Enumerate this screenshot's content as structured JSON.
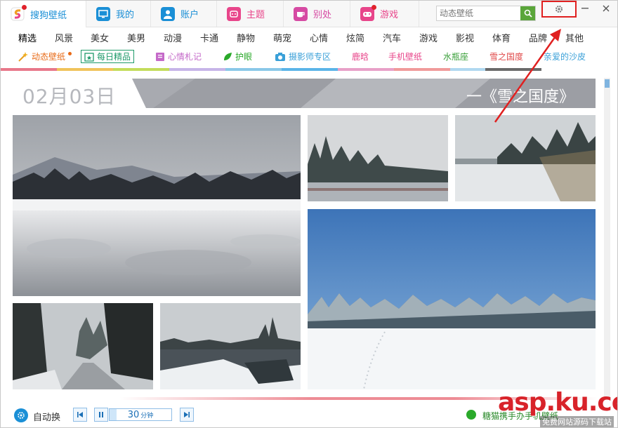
{
  "tabs": [
    {
      "label": "搜狗壁纸",
      "icon": "sogou-logo-icon",
      "color": "#1a8fd6"
    },
    {
      "label": "我的",
      "icon": "monitor-icon",
      "color": "#1a8fd6"
    },
    {
      "label": "账户",
      "icon": "user-icon",
      "color": "#1a8fd6"
    },
    {
      "label": "主题",
      "icon": "theme-icon",
      "color": "#e8458a"
    },
    {
      "label": "别处",
      "icon": "cup-icon",
      "color": "#d64aa3"
    },
    {
      "label": "游戏",
      "icon": "gamepad-icon",
      "color": "#e8458a"
    }
  ],
  "search": {
    "placeholder": "动态壁纸"
  },
  "categories": [
    "精选",
    "风景",
    "美女",
    "美男",
    "动漫",
    "卡通",
    "静物",
    "萌宠",
    "心情",
    "炫简",
    "汽车",
    "游戏",
    "影视",
    "体育",
    "品牌",
    "其他"
  ],
  "specials": [
    {
      "label": "动态壁纸",
      "color": "#e86a16"
    },
    {
      "label": "每日精品",
      "color": "#1e9a6a"
    },
    {
      "label": "心情札记",
      "color": "#c56ac9"
    },
    {
      "label": "护眼",
      "color": "#2aa92a"
    },
    {
      "label": "摄影师专区",
      "color": "#3aa0d8"
    },
    {
      "label": "鹿晗",
      "color": "#e8458a"
    },
    {
      "label": "手机壁纸",
      "color": "#e8458a"
    },
    {
      "label": "水瓶座",
      "color": "#3aa03a"
    },
    {
      "label": "雪之国度",
      "color": "#e04a4a"
    },
    {
      "label": "亲爱的沙皮",
      "color": "#3aa0d8"
    }
  ],
  "colorbar": [
    "#e8778a",
    "#f0c35a",
    "#c3dc5a",
    "#5ab4e8",
    "#9a8ad6",
    "#e8a0c8",
    "#b0d8f0",
    "#f09a9a",
    "#6a6a6a",
    "#ffffff"
  ],
  "daily": {
    "date": "02月03日",
    "theme": "一《雪之国度》"
  },
  "bottom": {
    "auto_label": "自动换",
    "timer_value": "30",
    "timer_unit": "分钟",
    "promo": "糖猫携手办手机壁纸"
  },
  "watermark": {
    "main": "asp.ku.com",
    "sub": "免费网站源码下载站"
  }
}
